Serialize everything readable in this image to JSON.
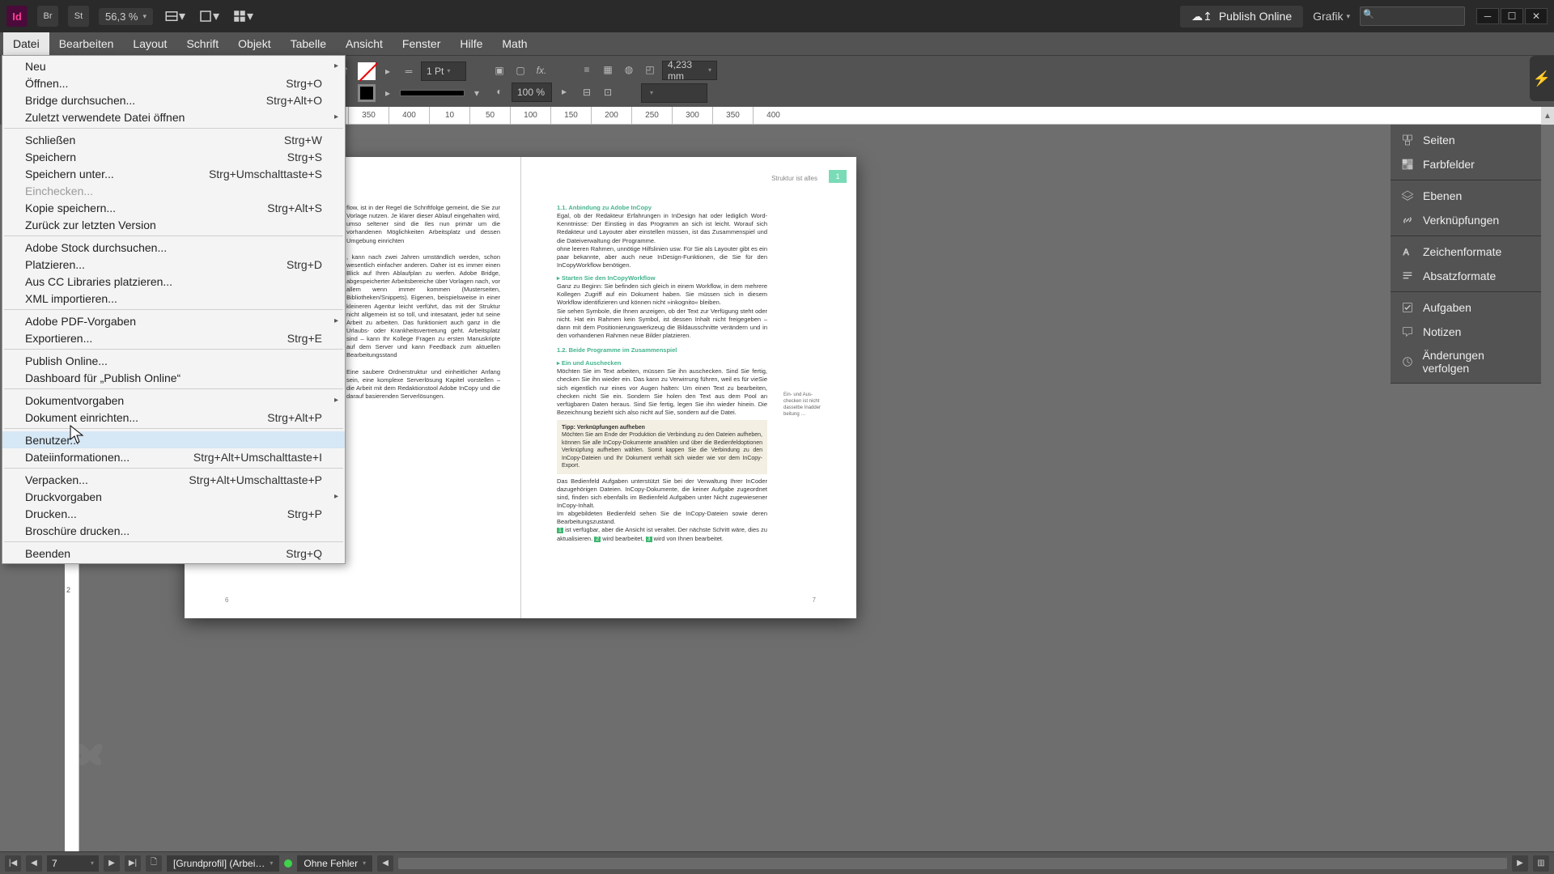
{
  "titlebar": {
    "app_logo": "Id",
    "br_label": "Br",
    "st_label": "St",
    "zoom_value": "56,3 %",
    "publish_label": "Publish Online",
    "help_label": "Grafik"
  },
  "menubar": {
    "items": [
      "Datei",
      "Bearbeiten",
      "Layout",
      "Schrift",
      "Objekt",
      "Tabelle",
      "Ansicht",
      "Fenster",
      "Hilfe",
      "Math"
    ]
  },
  "controlbar": {
    "stroke_weight": "1 Pt",
    "opacity": "100 %",
    "corner_radius": "4,233 mm"
  },
  "dropdown": {
    "groups": [
      [
        {
          "label": "Neu",
          "shortcut": "",
          "sub": true
        },
        {
          "label": "Öffnen...",
          "shortcut": "Strg+O"
        },
        {
          "label": "Bridge durchsuchen...",
          "shortcut": "Strg+Alt+O"
        },
        {
          "label": "Zuletzt verwendete Datei öffnen",
          "shortcut": "",
          "sub": true
        }
      ],
      [
        {
          "label": "Schließen",
          "shortcut": "Strg+W"
        },
        {
          "label": "Speichern",
          "shortcut": "Strg+S"
        },
        {
          "label": "Speichern unter...",
          "shortcut": "Strg+Umschalttaste+S"
        },
        {
          "label": "Einchecken...",
          "shortcut": "",
          "disabled": true
        },
        {
          "label": "Kopie speichern...",
          "shortcut": "Strg+Alt+S"
        },
        {
          "label": "Zurück zur letzten Version",
          "shortcut": ""
        }
      ],
      [
        {
          "label": "Adobe Stock durchsuchen...",
          "shortcut": ""
        },
        {
          "label": "Platzieren...",
          "shortcut": "Strg+D"
        },
        {
          "label": "Aus CC Libraries platzieren...",
          "shortcut": ""
        },
        {
          "label": "XML importieren...",
          "shortcut": ""
        }
      ],
      [
        {
          "label": "Adobe PDF-Vorgaben",
          "shortcut": "",
          "sub": true
        },
        {
          "label": "Exportieren...",
          "shortcut": "Strg+E"
        }
      ],
      [
        {
          "label": "Publish Online...",
          "shortcut": ""
        },
        {
          "label": "Dashboard für „Publish Online“",
          "shortcut": ""
        }
      ],
      [
        {
          "label": "Dokumentvorgaben",
          "shortcut": "",
          "sub": true
        },
        {
          "label": "Dokument einrichten...",
          "shortcut": "Strg+Alt+P"
        }
      ],
      [
        {
          "label": "Benutzer...",
          "shortcut": "",
          "hover": true
        },
        {
          "label": "Dateiinformationen...",
          "shortcut": "Strg+Alt+Umschalttaste+I"
        }
      ],
      [
        {
          "label": "Verpacken...",
          "shortcut": "Strg+Alt+Umschalttaste+P"
        },
        {
          "label": "Druckvorgaben",
          "shortcut": "",
          "sub": true
        },
        {
          "label": "Drucken...",
          "shortcut": "Strg+P"
        },
        {
          "label": "Broschüre drucken...",
          "shortcut": ""
        }
      ],
      [
        {
          "label": "Beenden",
          "shortcut": "Strg+Q"
        }
      ]
    ]
  },
  "ruler": {
    "ticks": [
      "100",
      "150",
      "200",
      "250",
      "300",
      "350",
      "400",
      "10",
      "50",
      "100",
      "150",
      "200",
      "250",
      "300",
      "350",
      "400"
    ]
  },
  "ruler_alt": [
    "100",
    "150",
    "200",
    "250",
    "300",
    "350",
    "400"
  ],
  "page": {
    "header_right": "Struktur ist alles",
    "page_number": "1",
    "left_col": "flow, ist in der Regel die Schriftfolge gemeint, die Sie zur Vorlage nutzen. Je klarer dieser Ablauf eingehalten wird, umso seltener sind die Iles nun primär um die vorhandenen Möglichkeiten Arbeitsplatz und dessen Umgebung einrichten\n\n, kann nach zwei Jahren umständlich werden, schon wesentlich einfacher anderen. Daher ist es immer einen Blick auf Ihren Ablaufplan zu werfen. Adobe Bridge, abgespeicherter Arbeitsbereiche über Vorlagen nach, vor allem wenn immer kommen (Musterseiten, Bibliotheken/Snippets). Eigenen, beispielsweise in einer kleineren Agentur leicht verführt, das mit der Struktur nicht allgemein ist so toll, und intesatant, jeder tut seine Arbeit zu arbeiten. Das funktioniert auch ganz in die Urlaubs- oder Krankheitsvertretung geht. Arbeitsplatz sind – kann Ihr Kollege Fragen zu ersten Manuskripte auf dem Server und kann Feedback zum aktuellen Bearbeitungsstand\n\nEine saubere Ordnerstruktur und einheitlicher Anfang sein, eine komplexe Serverlösung Kapitel vorstellen – die Arbeit mit dem Redaktionstool Adobe InCopy und die darauf basierenden Serverlösungen.",
    "h1_1": "1.1.   Anbindung zu Adobe InCopy",
    "p1": "Egal, ob der Redakteur Erfahrungen in InDesign hat oder lediglich Word-Kenntnisse: Der Einstieg in das Programm an sich ist leicht. Worauf sich Redakteur und Layouter aber einstellen müssen, ist das Zusammenspiel und die Dateiverwaltung der Programme.\nohne leeren Rahmen, unnötige Hilfslinien usw. Für Sie als Layouter gibt es ein paar bekannte, aber auch neue InDesign-Funktionen, die Sie für den InCopyWorkflow benötigen.",
    "h1_start": "▸  Starten Sie den InCopyWorkflow",
    "p2": "Ganz zu Beginn: Sie befinden sich gleich in einem Workflow, in dem mehrere Kollegen Zugriff auf ein Dokument haben. Sie müssen sich in diesem Workflow identifizieren und können nicht »inkognito« bleiben.\n   Sie sehen Symbole, die Ihnen anzeigen, ob der Text zur Verfügung steht oder nicht. Hat ein Rahmen kein Symbol, ist dessen Inhalt nicht freigegeben – dann mit dem Positionierungswerkzeug die Bildausschnitte verändern und in den vorhandenen Rahmen neue Bilder platzieren.",
    "h1_2": "1.2.   Beide Programme im Zusammenspiel",
    "h1_einaus": "▸  Ein und Auschecken",
    "p3": "Möchten Sie im Text arbeiten, müssen Sie ihn auschecken. Sind Sie fertig, checken Sie ihn wieder ein. Das kann zu Verwirrung führen, weil es für vieSie sich eigentlich nur eines vor Augen halten: Um einen Text zu bearbeiten, checken nicht Sie ein. Sondern Sie holen den Text aus dem Pool an verfügbaren Daten heraus. Sind Sie fertig, legen Sie ihn wieder hinein. Die Bezeichnung bezieht sich also nicht auf Sie, sondern auf die Datei.",
    "tip_title": "Tipp: Verknüpfungen aufheben",
    "tip_body": "Möchten Sie am Ende der Produktion die Verbindung zu den Dateien aufheben, können Sie alle InCopy-Dokumente anwählen und über die Bedienfeldoptionen Verknüpfung aufheben wählen. Somit kappen Sie die Verbindung zu den InCopy-Dateien und Ihr Dokument verhält sich wieder wie vor dem InCopy-Export.",
    "p4": "Das Bedienfeld Aufgaben unterstützt Sie bei der Verwaltung Ihrer InCoder dazugehörigen Dateien. InCopy-Dokumente, die keiner Aufgabe zugeordnet sind, finden sich ebenfalls im Bedienfeld Aufgaben unter Nicht zugewiesener InCopy-Inhalt.\n   Im abgebildeten Bedienfeld sehen Sie die InCopy-Dateien sowie deren Bearbeitungszustand.",
    "p4b": "ist verfügbar, aber die Ansicht ist veraltet. Der nächste Schritt wäre, dies zu aktualisieren.",
    "p4c": "wird bearbeitet,",
    "p4d": "wird von Ihnen bearbeitet.",
    "badge1": "1",
    "badge2": "2",
    "badge3": "3",
    "margin_note": "Ein- und Aus-\nchecken ist nicht\ndasselbe Inadder\nbeitung …",
    "foot_left": "6",
    "foot_right": "7"
  },
  "panels": {
    "groups": [
      [
        {
          "icon": "pages",
          "label": "Seiten"
        },
        {
          "icon": "swatch",
          "label": "Farbfelder"
        }
      ],
      [
        {
          "icon": "layers",
          "label": "Ebenen"
        },
        {
          "icon": "links",
          "label": "Verknüpfungen"
        }
      ],
      [
        {
          "icon": "char",
          "label": "Zeichenformate"
        },
        {
          "icon": "para",
          "label": "Absatzformate"
        }
      ],
      [
        {
          "icon": "task",
          "label": "Aufgaben"
        },
        {
          "icon": "note",
          "label": "Notizen"
        },
        {
          "icon": "track",
          "label": "Änderungen verfolgen"
        }
      ]
    ]
  },
  "statusbar": {
    "page": "7",
    "profile": "[Grundprofil] (Arbei…",
    "preflight": "Ohne Fehler"
  }
}
